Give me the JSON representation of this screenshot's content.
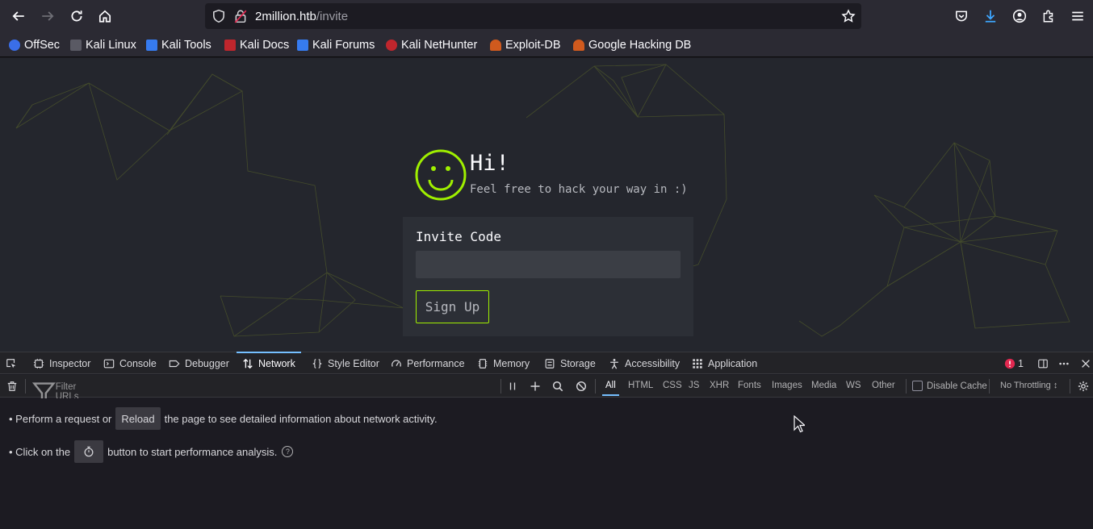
{
  "browser": {
    "url_host": "2million.htb",
    "url_path": "/invite",
    "bookmarks": [
      {
        "label": "OffSec",
        "color": "#3a6ee8"
      },
      {
        "label": "Kali Linux",
        "color": "#5a5a64"
      },
      {
        "label": "Kali Tools",
        "color": "#367bf0"
      },
      {
        "label": "Kali Docs",
        "color": "#c0262d"
      },
      {
        "label": "Kali Forums",
        "color": "#367bf0"
      },
      {
        "label": "Kali NetHunter",
        "color": "#c0262d"
      },
      {
        "label": "Exploit-DB",
        "color": "#d05a1e"
      },
      {
        "label": "Google Hacking DB",
        "color": "#d05a1e"
      }
    ]
  },
  "page": {
    "greeting": "Hi!",
    "subtitle": "Feel free to hack your way in :)",
    "invite_label": "Invite Code",
    "invite_value": "",
    "signup_label": "Sign Up",
    "accent_color": "#9fef00"
  },
  "devtools": {
    "tabs": [
      "Inspector",
      "Console",
      "Debugger",
      "Network",
      "Style Editor",
      "Performance",
      "Memory",
      "Storage",
      "Accessibility",
      "Application"
    ],
    "active_tab": "Network",
    "error_count": "1",
    "filter_placeholder": "Filter URLs",
    "type_filters": [
      "All",
      "HTML",
      "CSS",
      "JS",
      "XHR",
      "Fonts",
      "Images",
      "Media",
      "WS",
      "Other"
    ],
    "active_filter": "All",
    "disable_cache_label": "Disable Cache",
    "throttling_label": "No Throttling ↕",
    "msg1_before": "• Perform a request or",
    "msg1_button": "Reload",
    "msg1_after": "the page to see detailed information about network activity.",
    "msg2_before": "• Click on the",
    "msg2_after": "button to start performance analysis."
  }
}
